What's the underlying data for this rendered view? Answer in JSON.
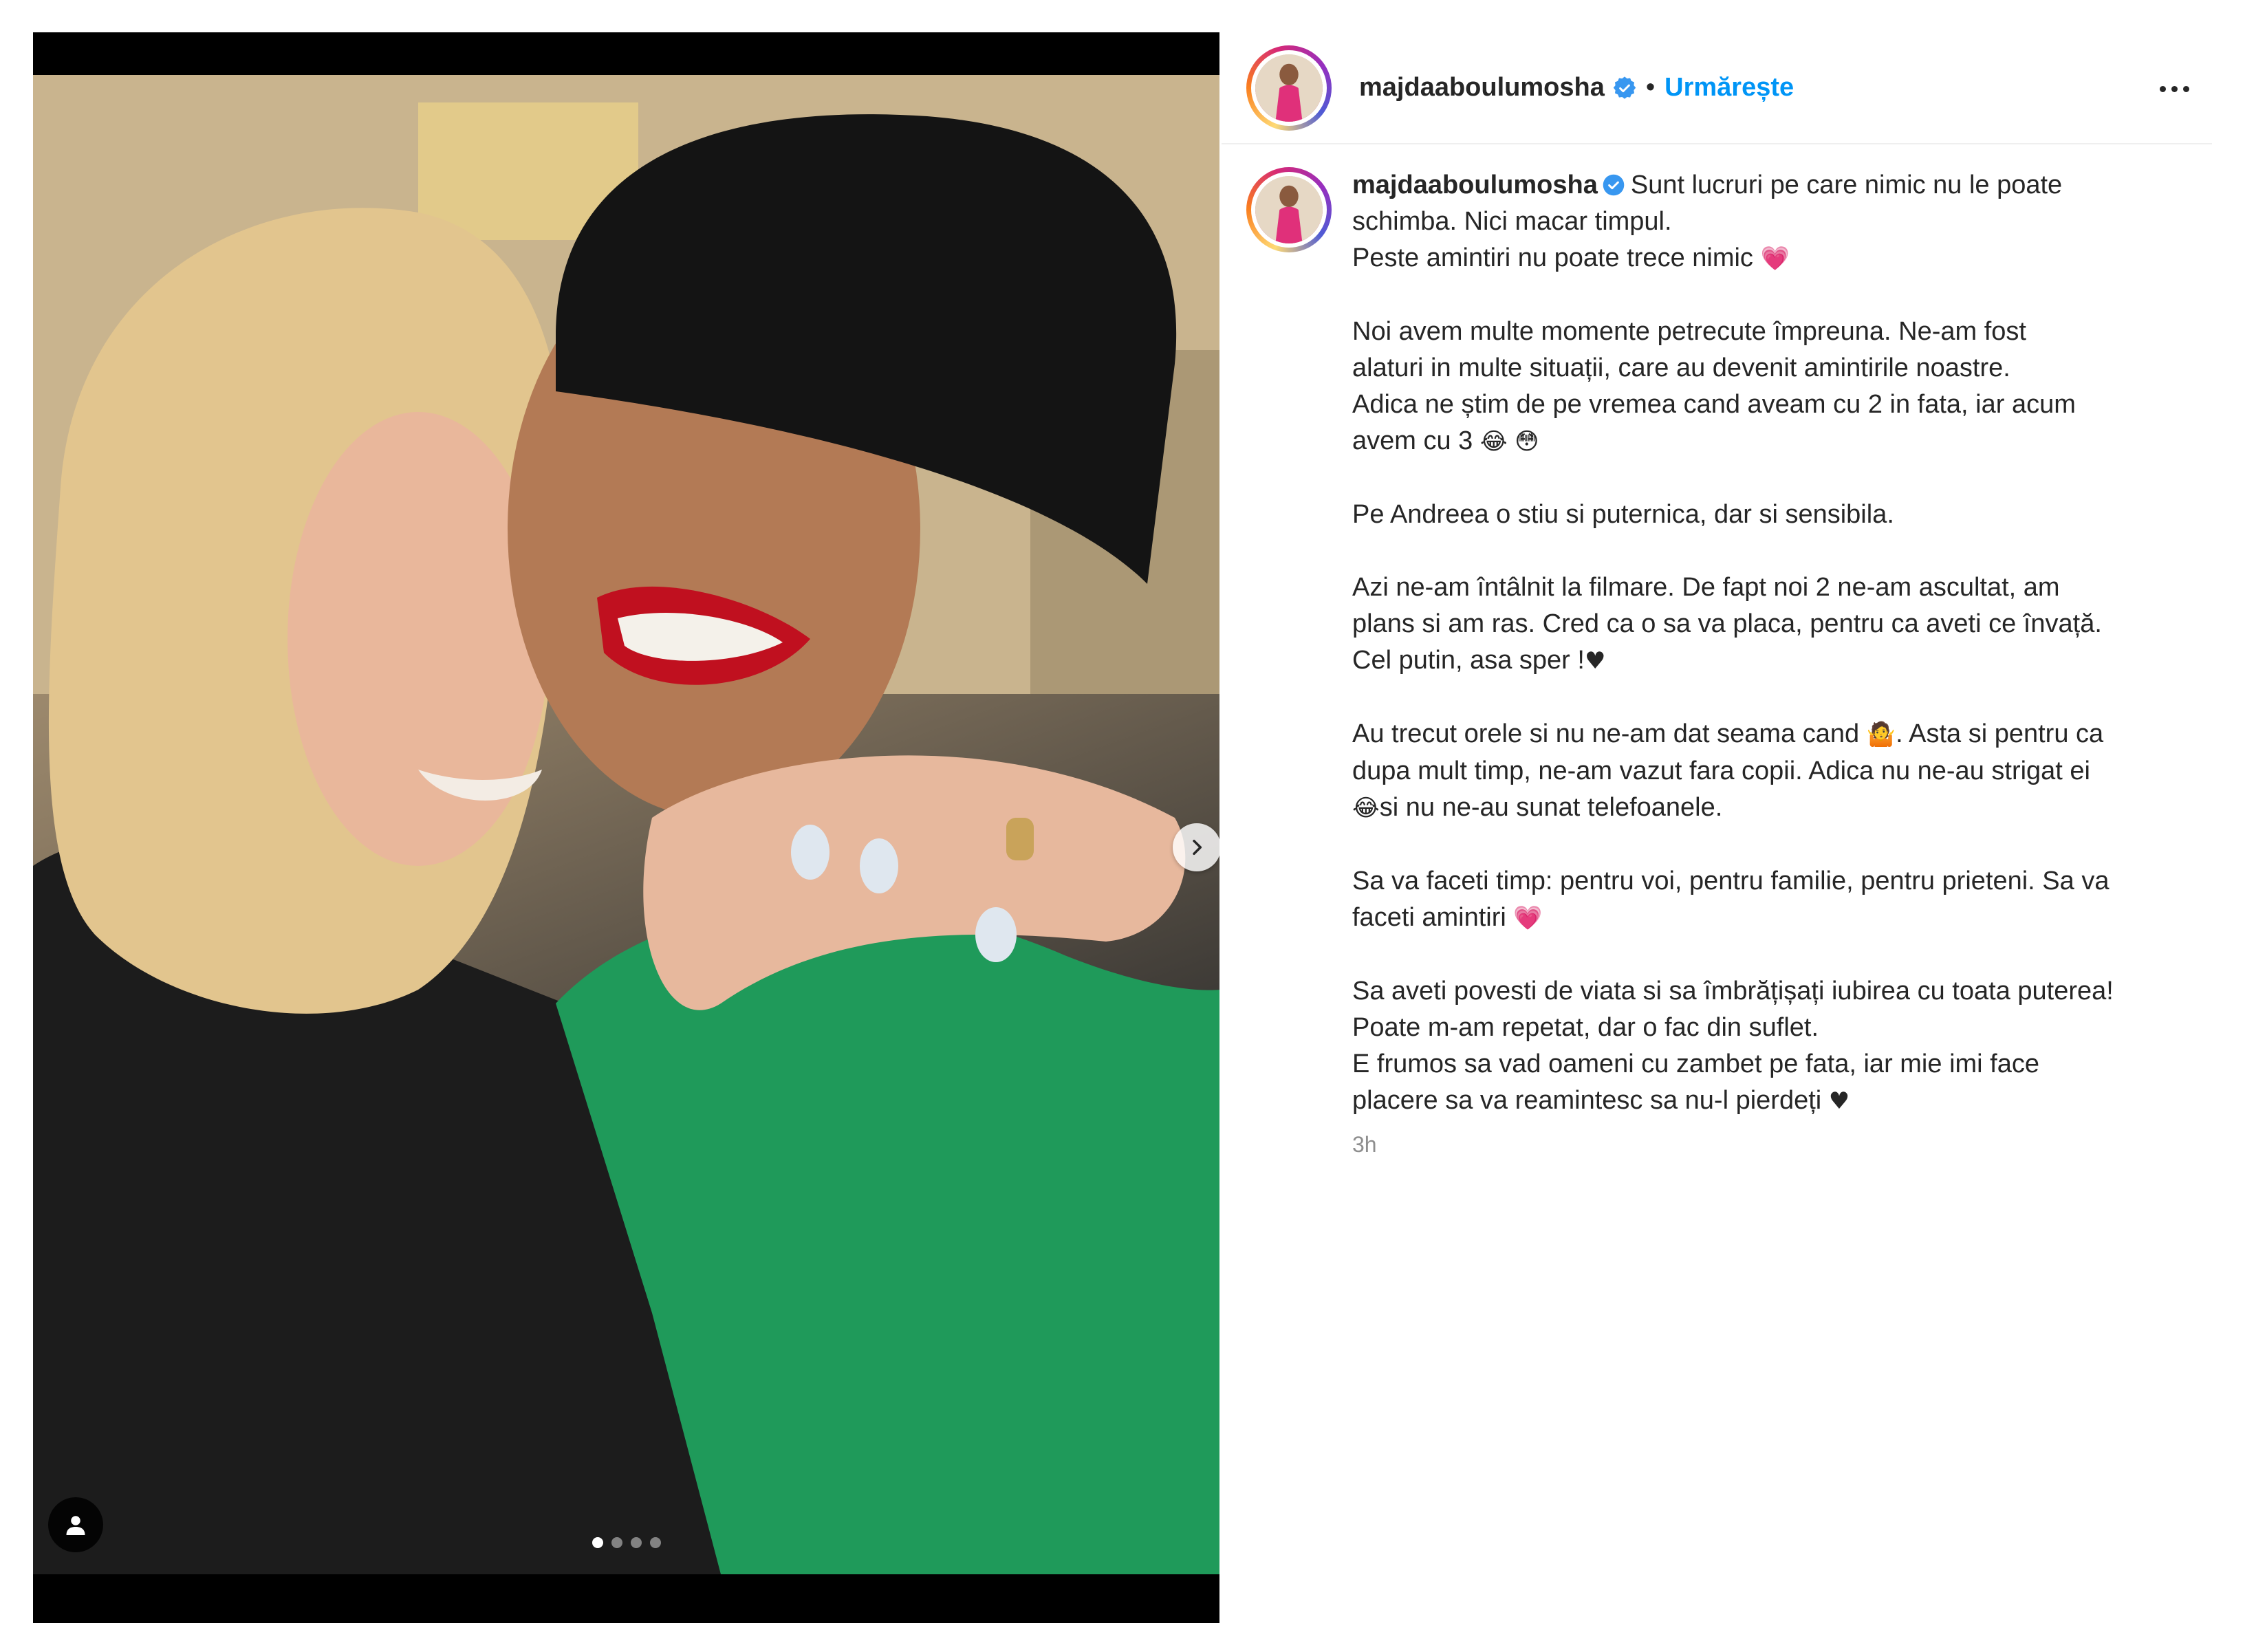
{
  "post": {
    "username": "majdaaboulumosha",
    "follow_label": "Urmărește",
    "separator": "•",
    "time": "3h",
    "carousel": {
      "slides": 4,
      "active_index": 0
    }
  },
  "caption": {
    "lines": [
      "Sunt lucruri pe care nimic nu le poate",
      "schimba. Nici macar timpul.",
      "Peste amintiri nu poate trece nimic",
      "",
      "Noi avem multe momente petrecute împreuna. Ne-am fost",
      "alaturi in multe situații, care au devenit amintirile noastre.",
      "Adica ne știm de pe vremea cand aveam cu 2 in fata, iar acum",
      "avem cu 3",
      "",
      "Pe Andreea o stiu si puternica, dar si sensibila.",
      "",
      "Azi ne-am întâlnit la filmare. De fapt noi 2 ne-am ascultat, am",
      "plans si am ras. Cred ca o sa va placa, pentru ca aveti ce învață.",
      "Cel putin, asa sper !",
      "",
      "Au trecut orele si nu ne-am dat seama cand",
      ". Asta si pentru ca",
      "dupa mult timp, ne-am vazut fara copii. Adica nu ne-au strigat ei",
      "si nu ne-au sunat telefoanele.",
      "",
      "Sa va faceti timp: pentru voi, pentru familie, pentru prieteni. Sa va",
      "faceti amintiri",
      "",
      "Sa aveti povesti de viata si sa îmbrățișați iubirea cu toata puterea!",
      "Poate m-am repetat, dar o fac din suflet.",
      "E frumos sa vad oameni cu zambet pe fata, iar mie imi face",
      "placere sa va reamintesc sa nu-l pierdeți"
    ],
    "emoji": {
      "growing_heart": "💗",
      "laughing": "😂",
      "flushed": "😳",
      "black_heart": "♥",
      "shrug": "🤷"
    }
  },
  "colors": {
    "link_blue": "#0095f6",
    "verified_blue": "#3897f0",
    "text": "#262626",
    "muted": "#8e8e8e"
  },
  "icons": {
    "verified": "verified-badge-icon",
    "more": "more-options-icon",
    "user_tag": "user-tag-icon",
    "next": "chevron-right-icon"
  }
}
